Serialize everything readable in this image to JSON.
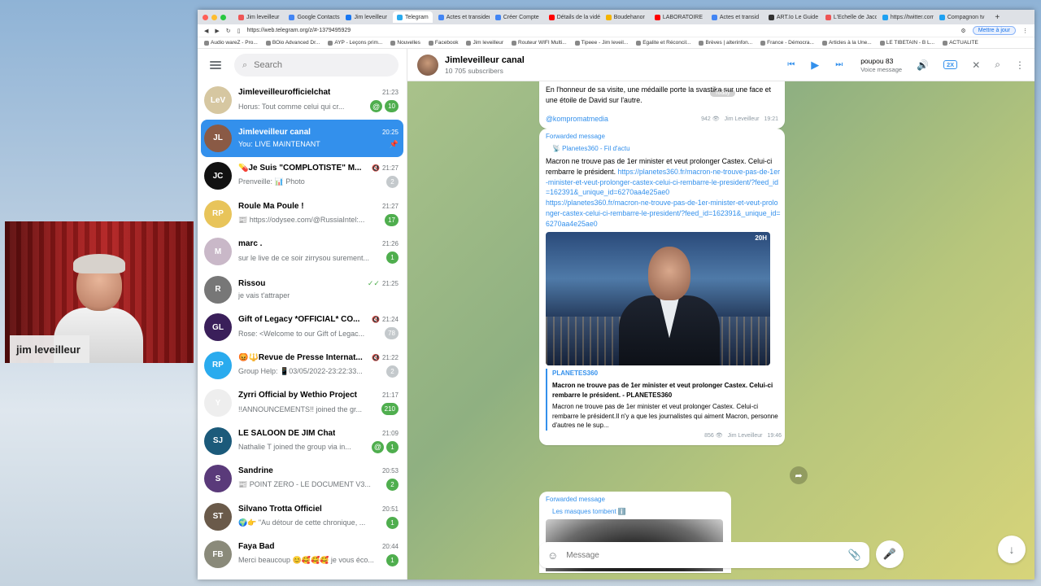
{
  "webcam": {
    "name": "jim leveilleur"
  },
  "browser": {
    "tabs": [
      {
        "label": "Jim leveilleur",
        "color": "#e55"
      },
      {
        "label": "Google Contacts",
        "color": "#4285f4"
      },
      {
        "label": "Jim leveilleur",
        "color": "#1877f2"
      },
      {
        "label": "Telegram",
        "color": "#2aabee",
        "active": true
      },
      {
        "label": "Actes et transidentité",
        "color": "#4285f4"
      },
      {
        "label": "Créer Compte",
        "color": "#4285f4"
      },
      {
        "label": "Détails de la vidéo",
        "color": "#ff0000"
      },
      {
        "label": "Boudehanor",
        "color": "#f4b400"
      },
      {
        "label": "LABORATOIRE",
        "color": "#ff0000"
      },
      {
        "label": "Actes et transid",
        "color": "#4285f4"
      },
      {
        "label": "ART.Io Le Guide",
        "color": "#333"
      },
      {
        "label": "L'Echelle de Jacob",
        "color": "#e55"
      },
      {
        "label": "https://twitter.com",
        "color": "#1da1f2"
      },
      {
        "label": "Compagnon tv",
        "color": "#1da1f2"
      }
    ],
    "url": "https://web.telegram.org/z/#-1379495929",
    "update_label": "Mettre à jour",
    "bookmarks": [
      "Audio wareZ - Pro...",
      "BOio Advanced Dr...",
      "AYP - Leçons prim...",
      "Nouvelles",
      "Facebook",
      "Jim leveilleur",
      "Routeur WIFI Multi...",
      "Tipeee - Jim leveil...",
      "Egalite et Réconcil...",
      "Brèves | alterinfon...",
      "France - Démocra...",
      "Articles à la Une...",
      "LE TIBETAIN - B L...",
      "ACTUALITE"
    ]
  },
  "sidebar": {
    "search_placeholder": "Search",
    "chats": [
      {
        "name": "Jimleveilleurofficielchat",
        "time": "21:23",
        "preview": "Horus: Tout comme celui qui cr...",
        "badge": "10",
        "mention": true,
        "avatar_bg": "#d6c7a1",
        "avatar_text": "LeV"
      },
      {
        "name": "Jimleveilleur canal",
        "time": "20:25",
        "preview": "You: LIVE MAINTENANT",
        "active": true,
        "pinned": true,
        "avatar_bg": "#8a5a45",
        "avatar_text": "JL"
      },
      {
        "name": "💊Je Suis \"COMPLOTISTE\" M...",
        "time": "21:27",
        "preview": "Prenveille: 📊 Photo",
        "badge": "2",
        "muted": true,
        "avatar_bg": "#111",
        "avatar_text": "JC"
      },
      {
        "name": "Roule Ma Poule !",
        "time": "21:27",
        "preview": "📰 https://odysee.com/@RussiaIntel:...",
        "badge": "17",
        "avatar_bg": "#e8c45a",
        "avatar_text": "RP"
      },
      {
        "name": "marc .",
        "time": "21:26",
        "preview": "sur le live de ce soir zirrysou surement...",
        "badge": "1",
        "avatar_bg": "#c9b8c8",
        "avatar_text": "M"
      },
      {
        "name": "Rissou",
        "time": "21:25",
        "preview": "je vais t'attraper",
        "read": true,
        "avatar_bg": "#777",
        "avatar_text": "R"
      },
      {
        "name": "Gift of Legacy *OFFICIAL* CO...",
        "time": "21:24",
        "preview": "Rose: <Welcome to our Gift of Legac...",
        "badge": "78",
        "muted": true,
        "avatar_bg": "#3a1f5a",
        "avatar_text": "GL"
      },
      {
        "name": "😡🔱Revue de Presse Internat...",
        "time": "21:22",
        "preview": "Group Help: 📱03/05/2022-23:22:33...",
        "badge": "2",
        "muted": true,
        "avatar_bg": "#2aabee",
        "avatar_text": "RP"
      },
      {
        "name": "Zyrri Official by Wethio Project",
        "time": "21:17",
        "preview": "!!ANNOUNCEMENTS!! joined the gr...",
        "badge": "210",
        "avatar_bg": "#eee",
        "avatar_text": "Y"
      },
      {
        "name": "LE SALOON DE JIM Chat",
        "time": "21:09",
        "preview": "Nathalie T joined the group via in...",
        "badge": "1",
        "mention": true,
        "avatar_bg": "#1b5a7a",
        "avatar_text": "SJ"
      },
      {
        "name": "Sandrine",
        "time": "20:53",
        "preview": "📰 POINT ZERO - LE DOCUMENT V3...",
        "badge": "2",
        "avatar_bg": "#5a3a7a",
        "avatar_text": "S"
      },
      {
        "name": "Silvano Trotta Officiel",
        "time": "20:51",
        "preview": "🌍👉 \"Au détour de cette chronique, ...",
        "badge": "1",
        "avatar_bg": "#6a5a4a",
        "avatar_text": "ST"
      },
      {
        "name": "Faya Bad",
        "time": "20:44",
        "preview": "Merci beaucoup 😊🥰🥰🥰 je vous éco...",
        "badge": "1",
        "avatar_bg": "#8a8a7a",
        "avatar_text": "FB"
      }
    ]
  },
  "header": {
    "title": "Jimleveilleur canal",
    "subscribers": "10 705 subscribers",
    "audio_title": "poupou 83",
    "audio_sub": "Voice message",
    "speed": "2X"
  },
  "messages": {
    "m1_text": "En l'honneur de sa visite, une médaille porte la svastika sur une face et une étoile de David sur l'autre.",
    "m1_link": "@kompromatmedia",
    "m1_views": "942",
    "m1_author": "Jim Leveilleur",
    "m1_time": "19:21",
    "date_pill": "Today",
    "m2_fwd": "Forwarded message",
    "m2_source": "📡 Planetes360 - Fil d'actu",
    "m2_text": "Macron ne trouve pas de 1er minister et veut prolonger Castex. Celui-ci rembarre le président.",
    "m2_link1": "https://planetes360.fr/macron-ne-trouve-pas-de-1er-minister-et-veut-prolonger-castex-celui-ci-rembarre-le-president/?feed_id=162391&_unique_id=6270aa4e25ae0",
    "m2_link2": "https://planetes360.fr/macron-ne-trouve-pas-de-1er-minister-et-veut-prolonger-castex-celui-ci-rembarre-le-president/?feed_id=162391&_unique_id=6270aa4e25ae0",
    "m2_photo_tag": "20H",
    "m2_preview_site": "PLANETES360",
    "m2_preview_title": "Macron ne trouve pas de 1er minister et veut prolonger Castex. Celui-ci rembarre le président. - PLANETES360",
    "m2_preview_desc": "Macron ne trouve pas de 1er minister et veut prolonger Castex. Celui-ci rembarre le président.Il n'y a que les journalistes qui aiment Macron, personne d'autres ne le sup...",
    "m2_views": "856",
    "m2_author": "Jim Leveilleur",
    "m2_time": "19:46",
    "m3_fwd": "Forwarded message",
    "m3_source": "Les masques tombent ℹ️"
  },
  "composer": {
    "placeholder": "Message"
  }
}
